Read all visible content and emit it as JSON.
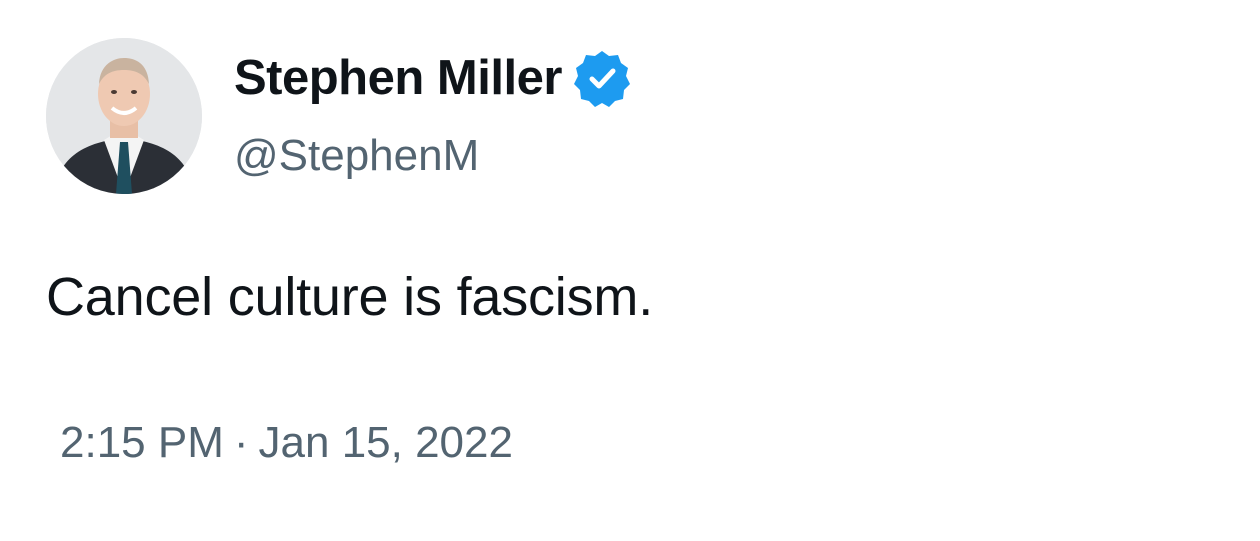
{
  "tweet": {
    "author": {
      "display_name": "Stephen Miller",
      "handle": "@StephenM",
      "verified": true,
      "badge_color": "#1d9bf0"
    },
    "text": "Cancel culture is fascism.",
    "time": "2:15 PM",
    "separator": "·",
    "date": "Jan 15, 2022"
  },
  "colors": {
    "primary_text": "#0f1419",
    "secondary_text": "#536471",
    "background": "#ffffff"
  }
}
